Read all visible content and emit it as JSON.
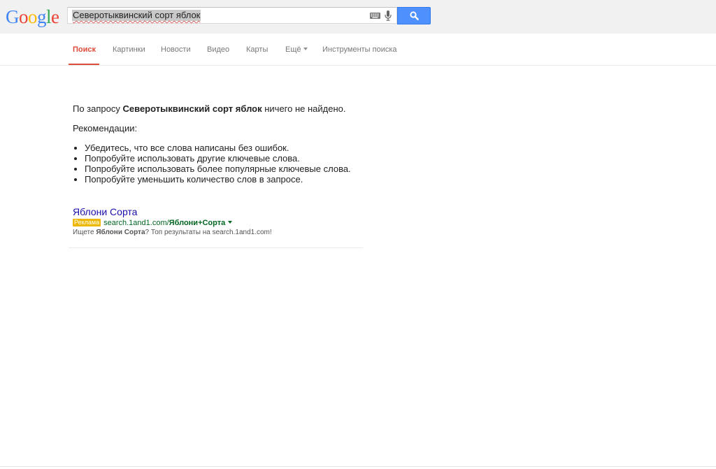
{
  "logo": {
    "letters": [
      {
        "char": "G",
        "color": "#4285f4"
      },
      {
        "char": "o",
        "color": "#ea4335"
      },
      {
        "char": "o",
        "color": "#fbbc05"
      },
      {
        "char": "g",
        "color": "#4285f4"
      },
      {
        "char": "l",
        "color": "#34a853"
      },
      {
        "char": "e",
        "color": "#ea4335"
      }
    ]
  },
  "search": {
    "query": "Северотыквинский сорт яблок",
    "button_icon": "search-icon",
    "keyboard_icon": "keyboard-icon",
    "mic_icon": "microphone-icon"
  },
  "tabs": [
    {
      "label": "Поиск",
      "active": true
    },
    {
      "label": "Картинки"
    },
    {
      "label": "Новости"
    },
    {
      "label": "Видео"
    },
    {
      "label": "Карты"
    },
    {
      "label": "Ещё"
    },
    {
      "label": "Инструменты поиска"
    }
  ],
  "results": {
    "no_results_prefix": "По запросу ",
    "no_results_query": "Северотыквинский сорт яблок",
    "no_results_suffix": " ничего не найдено.",
    "recommendations_title": "Рекомендации:",
    "tips": [
      "Убедитесь, что все слова написаны без ошибок.",
      "Попробуйте использовать другие ключевые слова.",
      "Попробуйте использовать более популярные ключевые слова.",
      "Попробуйте уменьшить количество слов в запросе."
    ]
  },
  "ad": {
    "title": "Яблони Сорта",
    "badge": "Реклама",
    "url_plain": "search.1and1.com/",
    "url_bold": "Яблони+Сорта",
    "desc_1": "Ищете ",
    "desc_bold": "Яблони Сорта",
    "desc_2": "? Топ результаты на search.1and1.com!"
  },
  "colors": {
    "accent_red": "#dd4b39",
    "link_blue": "#1a0dab",
    "url_green": "#006621",
    "button_blue": "#4d90fe",
    "ad_badge": "#edb802"
  }
}
